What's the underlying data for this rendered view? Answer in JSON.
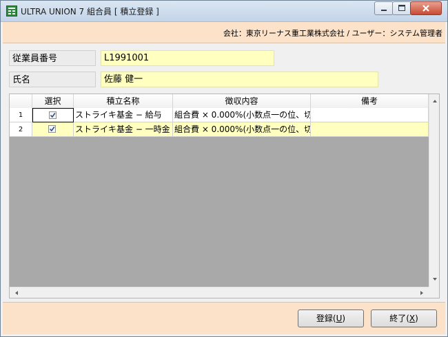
{
  "window": {
    "title": "ULTRA UNION 7 組合員 [ 積立登録 ]",
    "icon": "app-grid-icon"
  },
  "info": {
    "text": "会社：東京リーナス重工業株式会社 / ユーザー：システム管理者"
  },
  "form": {
    "employee_number_label": "従業員番号",
    "employee_number_value": "L1991001",
    "name_label": "氏名",
    "name_value": "佐藤 健一"
  },
  "grid": {
    "columns": [
      "選択",
      "積立名称",
      "徴収内容",
      "備考"
    ],
    "rows": [
      {
        "num": "1",
        "checked": true,
        "name": "ストライキ基金 − 給与",
        "content": "組合費 × 0.000%(小数点一の位、切",
        "note": ""
      },
      {
        "num": "2",
        "checked": true,
        "name": "ストライキ基金 − 一時金",
        "content": "組合費 × 0.000%(小数点一の位、切",
        "note": ""
      }
    ]
  },
  "buttons": {
    "register": "登録",
    "register_mnemonic": "U",
    "exit": "終了",
    "exit_mnemonic": "X"
  },
  "colors": {
    "accent_bar": "#fbe2c8",
    "input_bg": "#ffffc0",
    "selected_row": "#ffffc0"
  }
}
